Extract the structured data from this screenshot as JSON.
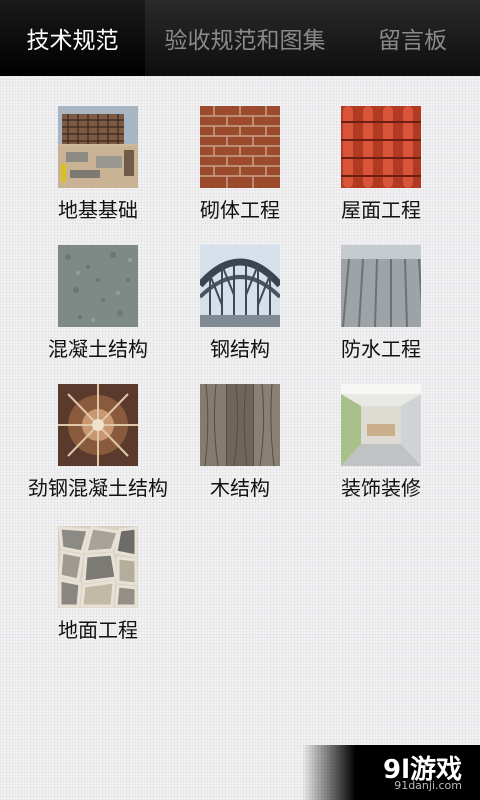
{
  "tabs": [
    {
      "label": "技术规范",
      "active": true
    },
    {
      "label": "验收规范和图集",
      "active": false
    },
    {
      "label": "留言板",
      "active": false
    }
  ],
  "items": [
    {
      "label": "地基基础",
      "icon": "construction-site-photo"
    },
    {
      "label": "砌体工程",
      "icon": "brick-wall-photo"
    },
    {
      "label": "屋面工程",
      "icon": "roof-tiles-photo"
    },
    {
      "label": "混凝土结构",
      "icon": "concrete-surface-photo"
    },
    {
      "label": "钢结构",
      "icon": "steel-bridge-photo"
    },
    {
      "label": "防水工程",
      "icon": "metal-roof-photo"
    },
    {
      "label": "劲钢混凝土结构",
      "icon": "steel-frame-photo"
    },
    {
      "label": "木结构",
      "icon": "wood-planks-photo"
    },
    {
      "label": "装饰装修",
      "icon": "interior-room-photo"
    },
    {
      "label": "地面工程",
      "icon": "stone-floor-photo"
    }
  ],
  "watermark": {
    "main": "9l游戏",
    "sub": "91danji.com"
  }
}
